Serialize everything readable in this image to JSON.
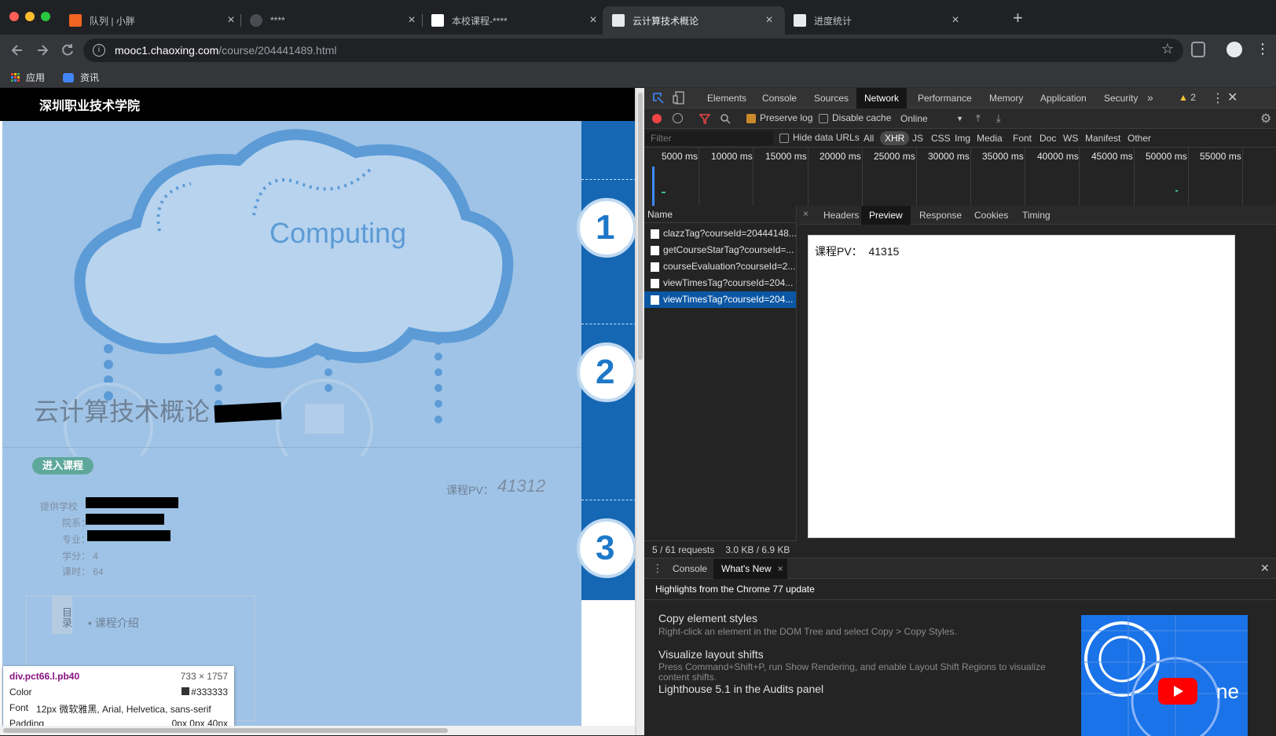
{
  "browser": {
    "tabs": [
      {
        "title": "队列 | 小胖",
        "active": false
      },
      {
        "title": "****",
        "active": false
      },
      {
        "title": "本校课程-****",
        "active": false
      },
      {
        "title": "云计算技术概论",
        "active": true
      },
      {
        "title": "进度统计",
        "active": false
      }
    ],
    "url_host": "mooc1.chaoxing.com",
    "url_path": "/course/204441489.html",
    "bookmarks": [
      "应用",
      "资讯"
    ]
  },
  "page": {
    "school": "深圳职业技术学院",
    "banner_word": "Computing",
    "course_title": "云计算技术概论",
    "enter_button": "进入课程",
    "pv_label": "课程PV：",
    "pv_value": "41312",
    "info_labels": [
      "提供学校",
      "院系：",
      "专业："
    ],
    "credit": "学分：  4",
    "hours": "课时：  64",
    "catalog_tab": "目录",
    "catalog_item": "课程介绍",
    "side_numbers": [
      "1",
      "2",
      "3"
    ]
  },
  "inspector_tooltip": {
    "selector": "div.pct66.l.pb40",
    "size": "733 × 1757",
    "color_label": "Color",
    "color_value": "#333333",
    "font_label": "Font",
    "font_value": "12px 微软雅黑, Arial, Helvetica, sans-serif",
    "padding_label": "Padding",
    "padding_value": "0px 0px 40px"
  },
  "devtools": {
    "main_tabs": [
      "Elements",
      "Console",
      "Sources",
      "Network",
      "Performance",
      "Memory",
      "Application",
      "Security"
    ],
    "active_tab": "Network",
    "warnings": "2",
    "preserve_log": "Preserve log",
    "disable_cache": "Disable cache",
    "throttle": "Online",
    "filter_placeholder": "Filter",
    "hide_data_urls": "Hide data URLs",
    "filter_types": [
      "All",
      "XHR",
      "JS",
      "CSS",
      "Img",
      "Media",
      "Font",
      "Doc",
      "WS",
      "Manifest",
      "Other"
    ],
    "active_filter": "XHR",
    "timeline_ticks": [
      "5000 ms",
      "10000 ms",
      "15000 ms",
      "20000 ms",
      "25000 ms",
      "30000 ms",
      "35000 ms",
      "40000 ms",
      "45000 ms",
      "50000 ms",
      "55000 ms"
    ],
    "name_header": "Name",
    "requests": [
      "clazzTag?courseId=20444148...",
      "getCourseStarTag?courseId=...",
      "courseEvaluation?courseId=2...",
      "viewTimesTag?courseId=204...",
      "viewTimesTag?courseId=204..."
    ],
    "selected_request": 4,
    "detail_tabs": [
      "Headers",
      "Preview",
      "Response",
      "Cookies",
      "Timing"
    ],
    "active_detail": "Preview",
    "preview_label": "课程PV：",
    "preview_value": "41315",
    "status_requests": "5 / 61 requests",
    "status_size": "3.0 KB / 6.9 KB",
    "drawer_tabs": [
      "Console",
      "What's New"
    ],
    "drawer_active": "What's New",
    "whats_new_title": "Highlights from the Chrome 77 update",
    "features": [
      {
        "title": "Copy element styles",
        "desc": "Right-click an element in the DOM Tree and select Copy > Copy Styles."
      },
      {
        "title": "Visualize layout shifts",
        "desc": "Press Command+Shift+P, run Show Rendering, and enable Layout Shift Regions to visualize content shifts."
      },
      {
        "title": "Lighthouse 5.1 in the Audits panel",
        "desc": ""
      }
    ],
    "video_text": "ne"
  },
  "colors": {
    "page_blue": "#9fc3e6",
    "side_blue": "#1567b3",
    "select_blue": "#0b57a4",
    "enter_green": "#5ea89b"
  }
}
